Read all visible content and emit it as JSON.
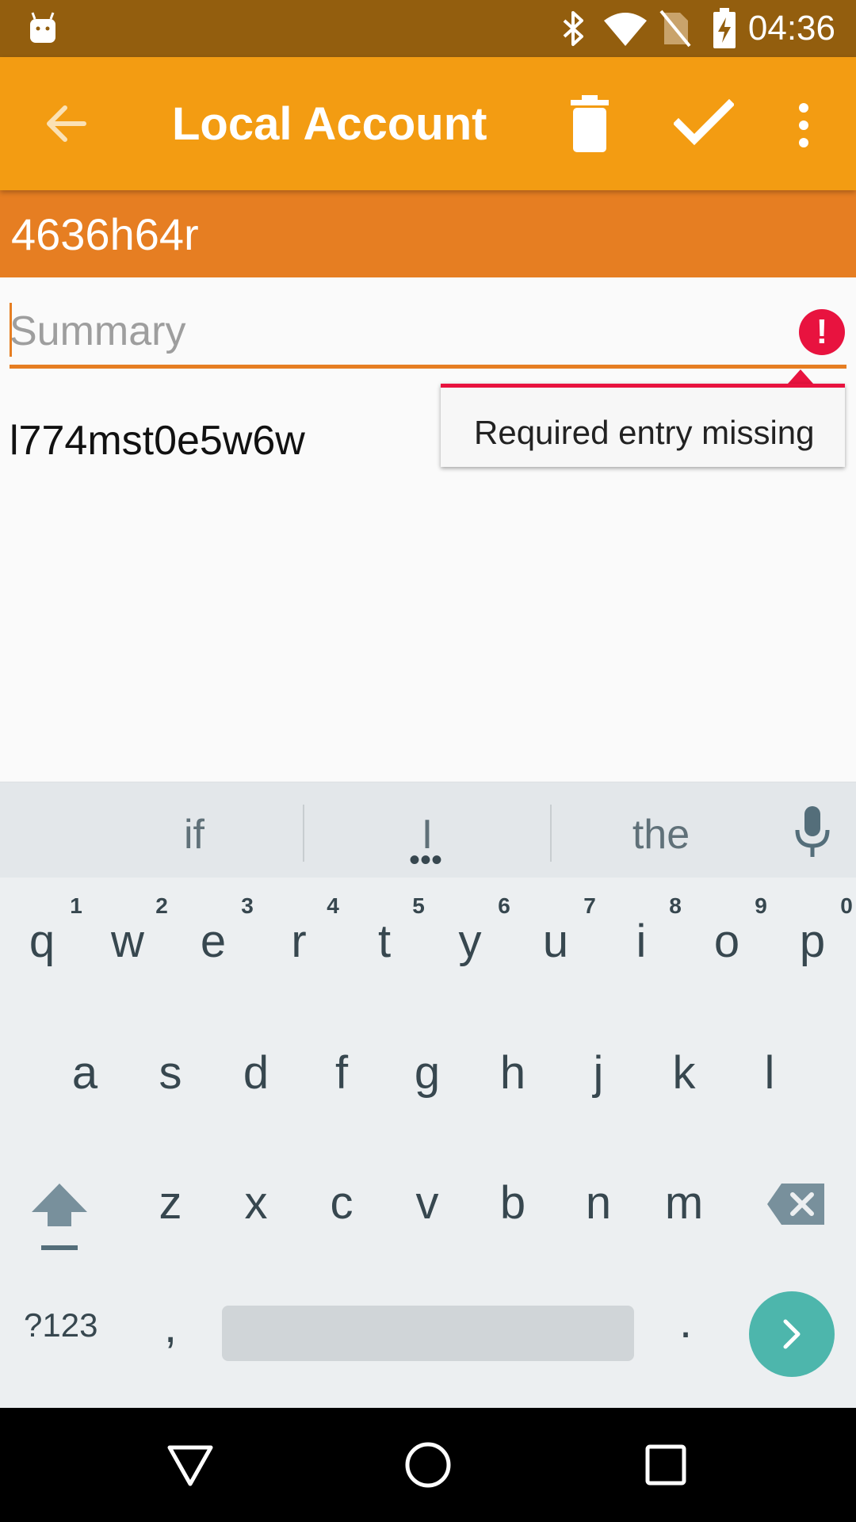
{
  "status_bar": {
    "time": "04:36",
    "icons": [
      "android-icon",
      "bluetooth-icon",
      "wifi-icon",
      "no-sim-icon",
      "battery-charging-icon"
    ]
  },
  "toolbar": {
    "title": "Local Account",
    "actions": [
      "back-arrow-icon",
      "delete-icon",
      "check-icon",
      "more-vert-icon"
    ]
  },
  "account": {
    "name": "4636h64r"
  },
  "summary_field": {
    "placeholder": "Summary",
    "value": ""
  },
  "error_popup": {
    "message": "Required entry missing"
  },
  "secondary_value": "l774mst0e5w6w",
  "keyboard": {
    "suggestions": [
      "if",
      "I",
      "the"
    ],
    "row1": [
      "q",
      "w",
      "e",
      "r",
      "t",
      "y",
      "u",
      "i",
      "o",
      "p"
    ],
    "row1_hints": [
      "1",
      "2",
      "3",
      "4",
      "5",
      "6",
      "7",
      "8",
      "9",
      "0"
    ],
    "row2": [
      "a",
      "s",
      "d",
      "f",
      "g",
      "h",
      "j",
      "k",
      "l"
    ],
    "row3": [
      "z",
      "x",
      "c",
      "v",
      "b",
      "n",
      "m"
    ],
    "symbols_key": "?123",
    "comma_key": ",",
    "period_key": "."
  },
  "colors": {
    "status_bar": "#935e0e",
    "toolbar": "#f39c12",
    "account_header": "#e67e22",
    "error": "#e8133f",
    "go_key": "#4db6ac"
  }
}
